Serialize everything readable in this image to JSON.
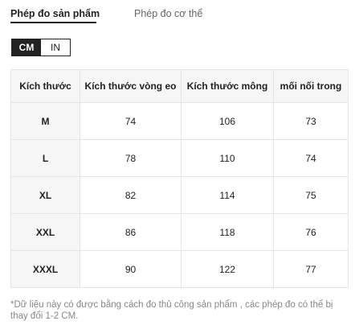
{
  "tabs": {
    "product": "Phép đo sản phẩm",
    "body": "Phép đo cơ thể"
  },
  "units": {
    "cm": "CM",
    "in": "IN",
    "selected": "CM"
  },
  "table": {
    "headers": [
      "Kích thước",
      "Kích thước vòng eo",
      "Kích thước mông",
      "mối nối trong"
    ],
    "rows": [
      [
        "M",
        "74",
        "106",
        "73"
      ],
      [
        "L",
        "78",
        "110",
        "74"
      ],
      [
        "XL",
        "82",
        "114",
        "75"
      ],
      [
        "XXL",
        "86",
        "118",
        "76"
      ],
      [
        "XXXL",
        "90",
        "122",
        "77"
      ]
    ]
  },
  "note": "*Dữ liệu này có được bằng cách đo thủ công sản phẩm , các phép đo có thể bị thay đổi 1-2 CM."
}
